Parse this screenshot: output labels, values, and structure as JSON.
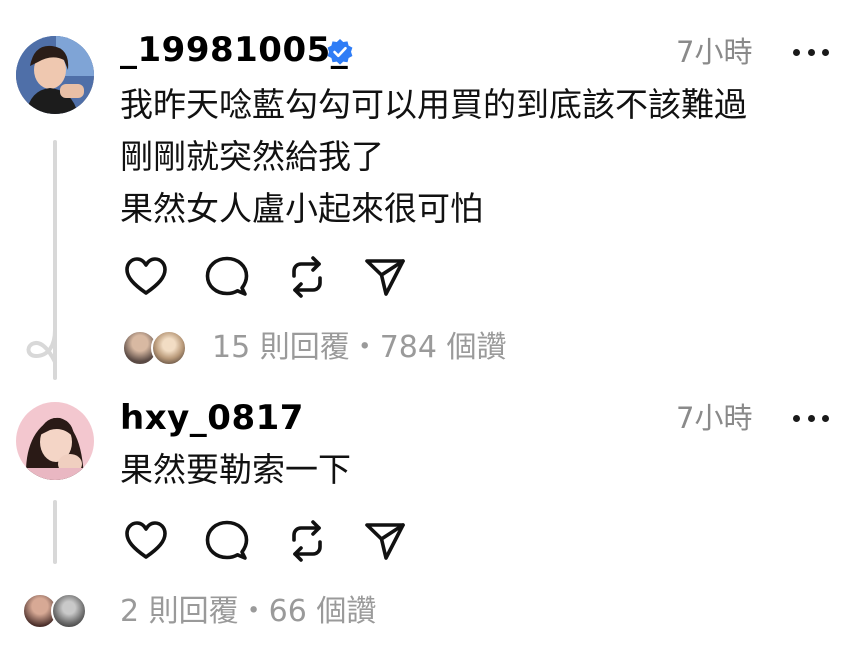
{
  "posts": [
    {
      "username": "_19981005_",
      "verified": true,
      "time": "7小時",
      "lines": [
        "我昨天唸藍勾勾可以用買的到底該不該難過",
        "剛剛就突然給我了",
        "果然女人盧小起來很可怕"
      ],
      "stats": "15 則回覆・784 個讚",
      "actions": [
        "heart-icon",
        "comment-icon",
        "repost-icon",
        "share-icon"
      ]
    },
    {
      "username": "hxy_0817",
      "verified": false,
      "time": "7小時",
      "lines": [
        "果然要勒索一下"
      ],
      "stats": "2 則回覆・66 個讚",
      "actions": [
        "heart-icon",
        "comment-icon",
        "repost-icon",
        "share-icon"
      ]
    }
  ],
  "colors": {
    "verified_badge": "#2f7df6",
    "muted": "#8a8a8a",
    "thread_line": "#d8d8d8"
  }
}
